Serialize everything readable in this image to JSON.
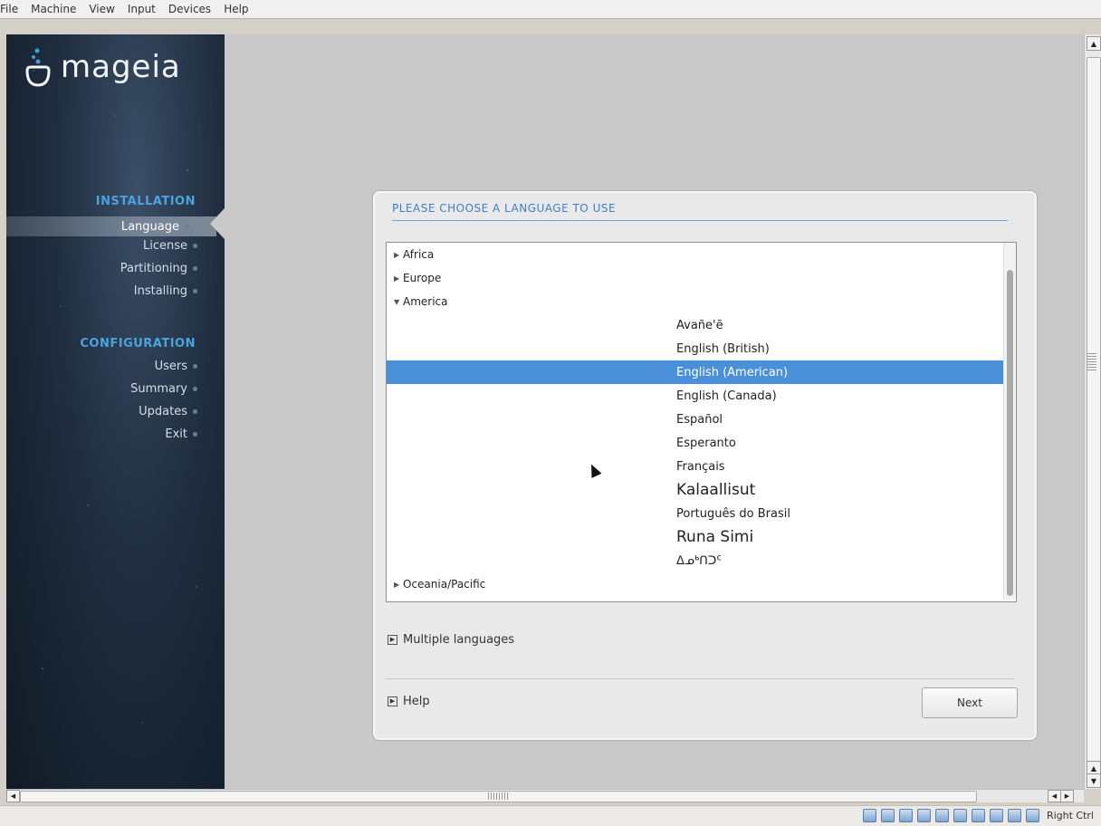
{
  "host_menu": [
    "File",
    "Machine",
    "View",
    "Input",
    "Devices",
    "Help"
  ],
  "sidebar": {
    "brand": "mageia",
    "installation_title": "INSTALLATION",
    "installation_steps": [
      "Language",
      "License",
      "Partitioning",
      "Installing"
    ],
    "configuration_title": "CONFIGURATION",
    "configuration_steps": [
      "Users",
      "Summary",
      "Updates",
      "Exit"
    ],
    "active_step": "Language"
  },
  "dialog": {
    "title": "PLEASE CHOOSE A LANGUAGE TO USE",
    "regions": {
      "africa": "Africa",
      "europe": "Europe",
      "america": "America",
      "oceania": "Oceania/Pacific"
    },
    "america_languages": [
      "Avañe'ẽ",
      "English (British)",
      "English (American)",
      "English (Canada)",
      "Español",
      "Esperanto",
      "Français",
      "Kalaallisut",
      "Português do Brasil",
      "Runa Simi",
      "ᐃᓄᒃᑎᑐᑦ"
    ],
    "selected_language": "English (American)",
    "multiple_languages_label": "Multiple languages",
    "help_label": "Help",
    "next_label": "Next"
  },
  "statusbar": {
    "host_key": "Right Ctrl"
  }
}
